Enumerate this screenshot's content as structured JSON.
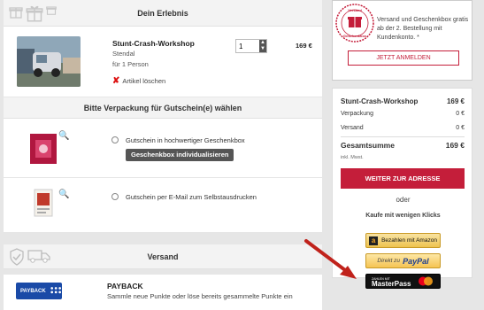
{
  "experience": {
    "header": "Dein Erlebnis",
    "product_title": "Stunt-Crash-Workshop",
    "location": "Stendal",
    "persons": "für 1 Person",
    "quantity": "1",
    "price": "169 €",
    "delete_label": "Artikel löschen"
  },
  "wrapping": {
    "header": "Bitte Verpackung für Gutschein(e) wählen",
    "option_box": "Gutschein in hochwertiger Geschenkbox",
    "customize_button": "Geschenkbox individualisieren",
    "option_email": "Gutschein per E-Mail zum Selbstausdrucken"
  },
  "shipping": {
    "header": "Versand"
  },
  "payback": {
    "logo_text": "PAYBACK",
    "title": "PAYBACK",
    "text": "Sammle neue Punkte oder löse bereits gesammelte Punkte ein"
  },
  "login_box": {
    "seal_top": "Versand",
    "seal_bottom": "Geschenkbox",
    "text": "Versand und Geschenkbox gratis ab der 2. Bestellung mit Kundenkonto. *",
    "button": "JETZT ANMELDEN"
  },
  "summary": {
    "product_label": "Stunt-Crash-Workshop",
    "product_price": "169 €",
    "packaging_label": "Verpackung",
    "packaging_price": "0 €",
    "shipping_label": "Versand",
    "shipping_price": "0 €",
    "total_label": "Gesamtsumme",
    "total_price": "169 €",
    "vat": "inkl. Mwst.",
    "checkout_button": "WEITER ZUR ADRESSE",
    "or": "oder",
    "few_clicks": "Kaufe mit wenigen Klicks"
  },
  "payment": {
    "amazon": "Bezahlen mit Amazon",
    "paypal_prefix": "Direkt zu",
    "paypal_brand": "PayPal",
    "masterpass_top": "ZAHLEN MIT",
    "masterpass_brand": "MasterPass"
  },
  "colors": {
    "accent": "#c41e3a",
    "payback_blue": "#1a4aa7"
  }
}
